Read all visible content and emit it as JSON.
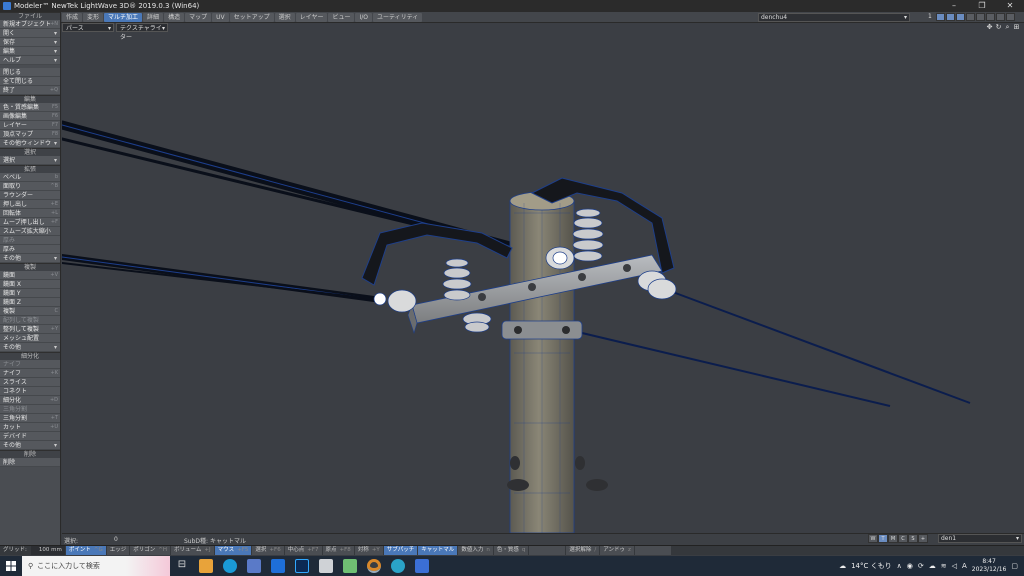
{
  "window": {
    "title": "Modeler™ NewTek LightWave 3D® 2019.0.3 (Win64)",
    "controls": [
      "–",
      "❐",
      "✕"
    ]
  },
  "menubar": {
    "tabs": [
      "作成",
      "変形",
      "マルチ加工",
      "詳細",
      "構造",
      "マップ",
      "UV",
      "セットアップ",
      "選択",
      "レイヤー",
      "ビュー",
      "I/O",
      "ユーティリティ"
    ],
    "active_tab": "マルチ加工",
    "object": "denchu4",
    "layer_number": "1"
  },
  "sidebar": {
    "file_head": "ファイル",
    "file_items": [
      {
        "label": "新規オブジェクト",
        "sc": "+N"
      },
      {
        "label": "開く",
        "dd": true
      },
      {
        "label": "保存",
        "dd": true
      },
      {
        "label": "編集",
        "dd": true
      },
      {
        "label": "ヘルプ",
        "dd": true
      }
    ],
    "close_items": [
      {
        "label": "閉じる",
        "sc": ""
      },
      {
        "label": "全て閉じる",
        "sc": ""
      },
      {
        "label": "終了",
        "sc": "+Q"
      }
    ],
    "edit_head": "編集",
    "edit_items": [
      {
        "label": "色・質感編集",
        "sc": "F5"
      },
      {
        "label": "画像編集",
        "sc": "F6"
      },
      {
        "label": "レイヤー",
        "sc": "F7"
      },
      {
        "label": "頂点マップ",
        "sc": "F8"
      },
      {
        "label": "その他ウィンドウ",
        "dd": true
      }
    ],
    "select_head": "選択",
    "select_items": [
      {
        "label": "選択",
        "dd": true
      }
    ],
    "extend_head": "拡張",
    "extend_items": [
      {
        "label": "ベベル",
        "sc": "b"
      },
      {
        "label": "面取り",
        "sc": "^B"
      },
      {
        "label": "ラウンダー",
        "sc": ""
      },
      {
        "label": "押し出し",
        "sc": "+E"
      },
      {
        "label": "回転体",
        "sc": "+L"
      },
      {
        "label": "ムーブ押し出し",
        "sc": "+F"
      },
      {
        "label": "スムーズ拡大縮小",
        "sc": ""
      },
      {
        "label": "厚み",
        "sc": "",
        "dim": true
      },
      {
        "label": "厚み",
        "sc": ""
      },
      {
        "label": "その他",
        "dd": true
      }
    ],
    "copy_head": "複製",
    "copy_items": [
      {
        "label": "鏡面",
        "sc": "+V"
      },
      {
        "label": "鏡面 X",
        "sc": ""
      },
      {
        "label": "鏡面 Y",
        "sc": ""
      },
      {
        "label": "鏡面 Z",
        "sc": ""
      },
      {
        "label": "複製",
        "sc": "C"
      },
      {
        "label": "配列して複製",
        "sc": "",
        "dim": true
      },
      {
        "label": "整列して複製",
        "sc": "+Y"
      },
      {
        "label": "メッシュ配置",
        "sc": ""
      },
      {
        "label": "その他",
        "dd": true
      }
    ],
    "subdiv_head": "細分化",
    "subdiv_items": [
      {
        "label": "ナイフ",
        "sc": "",
        "dim": true
      },
      {
        "label": "ナイフ",
        "sc": "+K"
      },
      {
        "label": "スライス",
        "sc": ""
      },
      {
        "label": "コネクト",
        "sc": ""
      },
      {
        "label": "細分化",
        "sc": "+D"
      },
      {
        "label": "三角分割",
        "sc": "",
        "dim": true
      },
      {
        "label": "三角分割",
        "sc": "+T"
      },
      {
        "label": "カット",
        "sc": "+U"
      },
      {
        "label": "デバイド",
        "sc": ""
      },
      {
        "label": "その他",
        "dd": true
      }
    ],
    "delete_head": "削除",
    "delete_items": [
      {
        "label": "削除",
        "sc": ""
      }
    ]
  },
  "viewport": {
    "view_mode": "パース",
    "shading": "テクスチャライター"
  },
  "status": {
    "selection_label": "選択:",
    "selection_count": "0",
    "subd_label": "SubD種:",
    "subd_value": "キャットマル",
    "view_buttons": [
      "W",
      "T",
      "M",
      "C",
      "S",
      "+"
    ],
    "active_view_button": "T",
    "layer": "den1"
  },
  "bottombar": {
    "grid_label": "グリッド:",
    "grid_value": "100 mm",
    "buttons": [
      {
        "label": "ポイント",
        "k": "^G",
        "on": true
      },
      {
        "label": "エッジ",
        "k": ""
      },
      {
        "label": "ポリゴン",
        "k": "^H"
      },
      {
        "label": "ボリューム",
        "k": "+J"
      },
      {
        "label": "マウス",
        "k": "+F5",
        "on": true
      },
      {
        "label": "選択",
        "k": "+F6"
      },
      {
        "label": "中心点",
        "k": "+F7"
      },
      {
        "label": "原点",
        "k": "+F8"
      },
      {
        "label": "対称",
        "k": "+Y"
      },
      {
        "label": "サブパッチ",
        "k": "",
        "on": true
      },
      {
        "label": "キャットマル",
        "k": "",
        "on": true
      },
      {
        "label": "数値入力",
        "k": "n"
      },
      {
        "label": "色・質感",
        "k": "q"
      },
      {
        "label": "",
        "k": ""
      },
      {
        "label": "選択解除",
        "k": "/"
      },
      {
        "label": "アンドゥ",
        "k": "z"
      },
      {
        "label": "",
        "k": ""
      }
    ]
  },
  "taskbar": {
    "search_placeholder": "ここに入力して検索",
    "weather": "14°C くもり",
    "ime": "A",
    "time": "8:47",
    "date": "2023/12/16"
  }
}
